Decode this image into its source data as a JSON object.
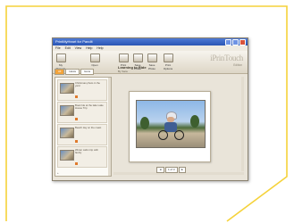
{
  "window": {
    "title": "PrintMyHeart for Pandit",
    "menu": [
      "File",
      "Edit",
      "View",
      "Help",
      "Help"
    ]
  },
  "toolbar": {
    "items": [
      "My Projects",
      "Open",
      "Print",
      "Save Photo",
      "Save Photo",
      "Print Options"
    ],
    "brand": "iPrinTouch",
    "brand_sub": "Edition"
  },
  "tabs": [
    "All",
    "Hosts",
    "Icons"
  ],
  "document": {
    "title": "Learning to Ride",
    "subtitle": "By Sara"
  },
  "sidebar": {
    "items": [
      {
        "text": "Christmas photo in the yard"
      },
      {
        "text": "Boat ride at the lake Lake House Trip"
      },
      {
        "text": "Beach day on the coast"
      },
      {
        "text": "Winter cabin trip with family"
      }
    ],
    "footer": "+"
  },
  "page_nav": [
    "◄",
    "1 of 3",
    "►"
  ],
  "colors": {
    "accent": "#f2a33a",
    "frame": "#f5d23a",
    "titlebar": "#2a55b4"
  }
}
